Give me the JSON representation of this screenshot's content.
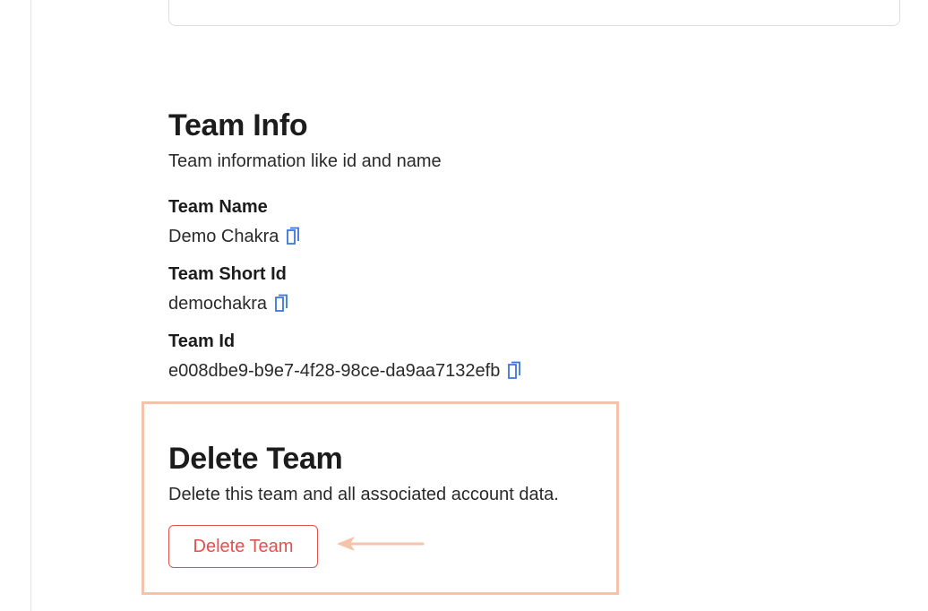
{
  "team_info": {
    "title": "Team Info",
    "description": "Team information like id and name",
    "fields": [
      {
        "label": "Team Name",
        "value": "Demo Chakra"
      },
      {
        "label": "Team Short Id",
        "value": "demochakra"
      },
      {
        "label": "Team Id",
        "value": "e008dbe9-b9e7-4f28-98ce-da9aa7132efb"
      }
    ]
  },
  "delete_team": {
    "title": "Delete Team",
    "description": "Delete this team and all associated account data.",
    "button_label": "Delete Team"
  },
  "colors": {
    "accent_blue": "#3b74d9",
    "danger_red": "#e0524c",
    "highlight_peach": "#f4c3a9"
  },
  "icons": {
    "copy": "copy-icon",
    "annotation_arrow": "arrow-left-icon"
  }
}
